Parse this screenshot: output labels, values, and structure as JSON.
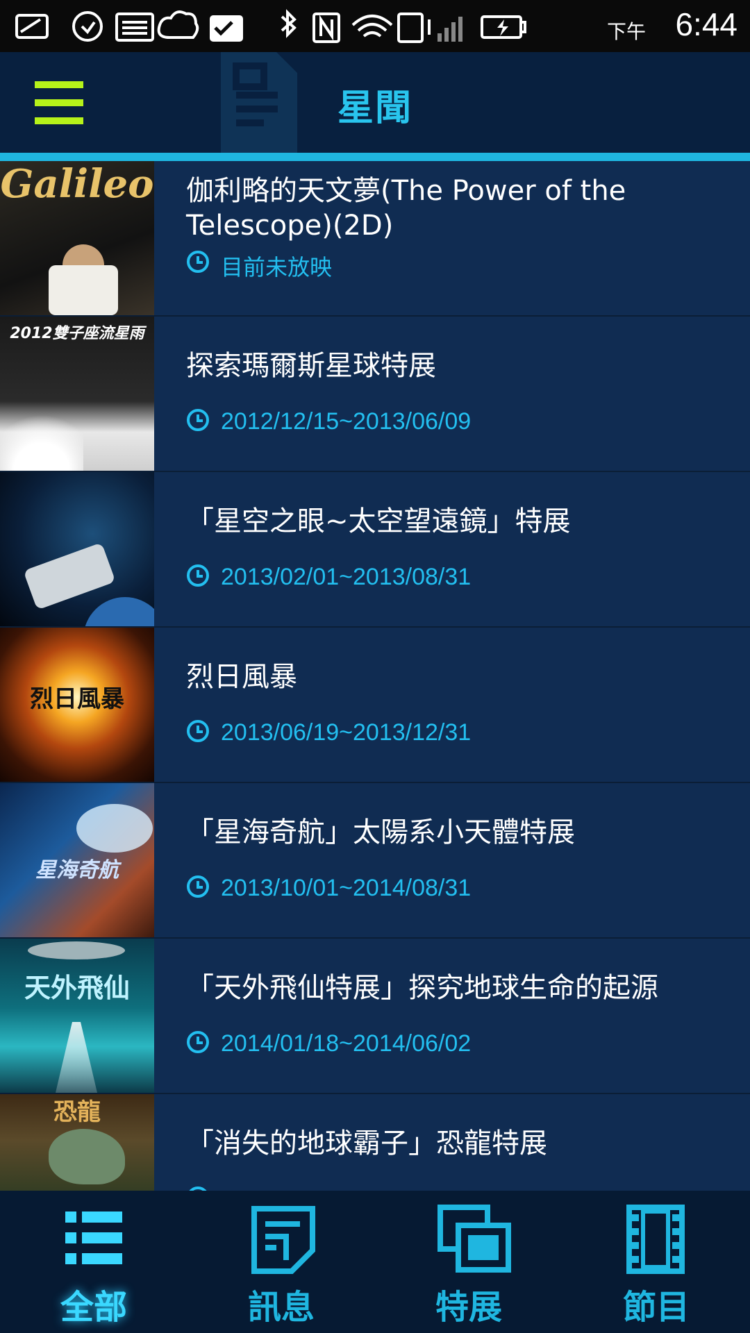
{
  "status_bar": {
    "ampm": "下午",
    "time": "6:44"
  },
  "header": {
    "title": "星聞"
  },
  "items": [
    {
      "title": "伽利略的天文夢(The Power of the Telescope)(2D)",
      "date": "目前未放映",
      "thumb_text": "Galileo"
    },
    {
      "title": "探索瑪爾斯星球特展",
      "date": "2012/12/15~2013/06/09",
      "thumb_text": "2012雙子座流星雨"
    },
    {
      "title": "「星空之眼~太空望遠鏡」特展",
      "date": "2013/02/01~2013/08/31",
      "thumb_text": ""
    },
    {
      "title": "烈日風暴",
      "date": "2013/06/19~2013/12/31",
      "thumb_text": "烈日風暴"
    },
    {
      "title": "「星海奇航」太陽系小天體特展",
      "date": "2013/10/01~2014/08/31",
      "thumb_text": "星海奇航"
    },
    {
      "title": "「天外飛仙特展」探究地球生命的起源",
      "date": "2014/01/18~2014/06/02",
      "thumb_text": "天外飛仙"
    },
    {
      "title": "「消失的地球霸子」恐龍特展",
      "date": "",
      "thumb_text": "恐龍"
    }
  ],
  "bottom_nav": [
    {
      "label": "全部",
      "icon": "list-icon",
      "active": true
    },
    {
      "label": "訊息",
      "icon": "document-icon",
      "active": false
    },
    {
      "label": "特展",
      "icon": "gallery-icon",
      "active": false
    },
    {
      "label": "節目",
      "icon": "film-icon",
      "active": false
    }
  ],
  "colors": {
    "accent": "#1fb6e0",
    "menu": "#b6f21a",
    "list_bg": "#102c52",
    "date_text": "#23bff0"
  }
}
